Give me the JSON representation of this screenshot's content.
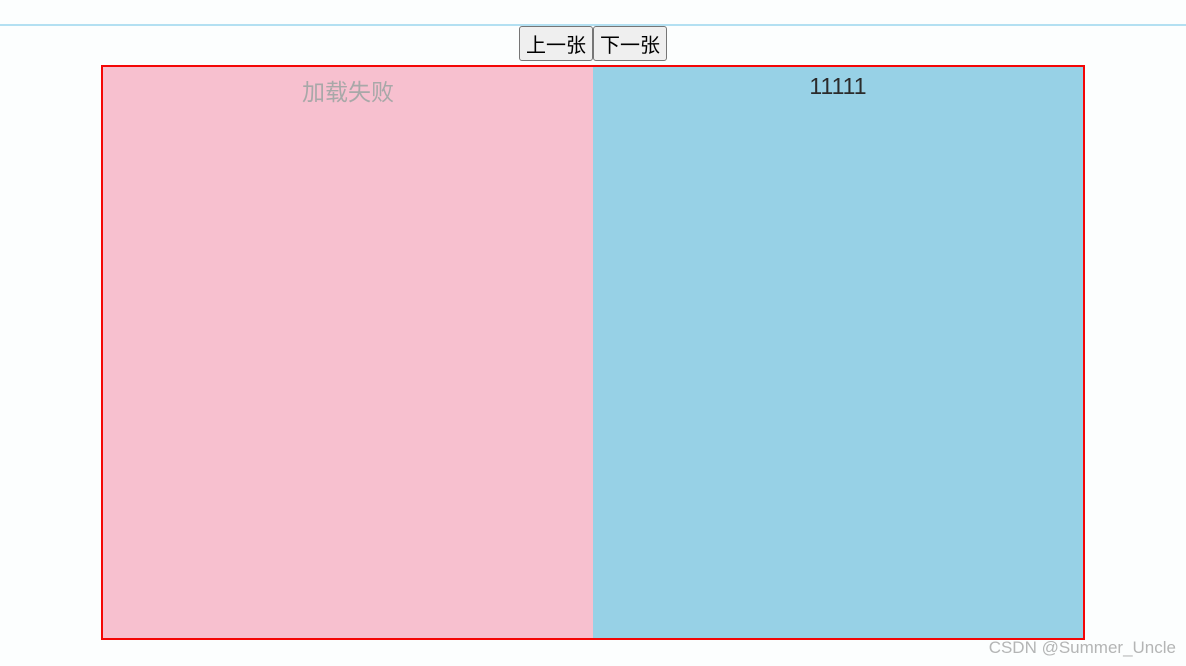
{
  "buttons": {
    "prev": "上一张",
    "next": "下一张"
  },
  "panels": {
    "left": {
      "text": "加载失败",
      "bgColor": "#f7c0cf"
    },
    "right": {
      "text": "11111",
      "bgColor": "#97d1e6"
    }
  },
  "watermark": "CSDN @Summer_Uncle",
  "borderColor": "#f40606"
}
